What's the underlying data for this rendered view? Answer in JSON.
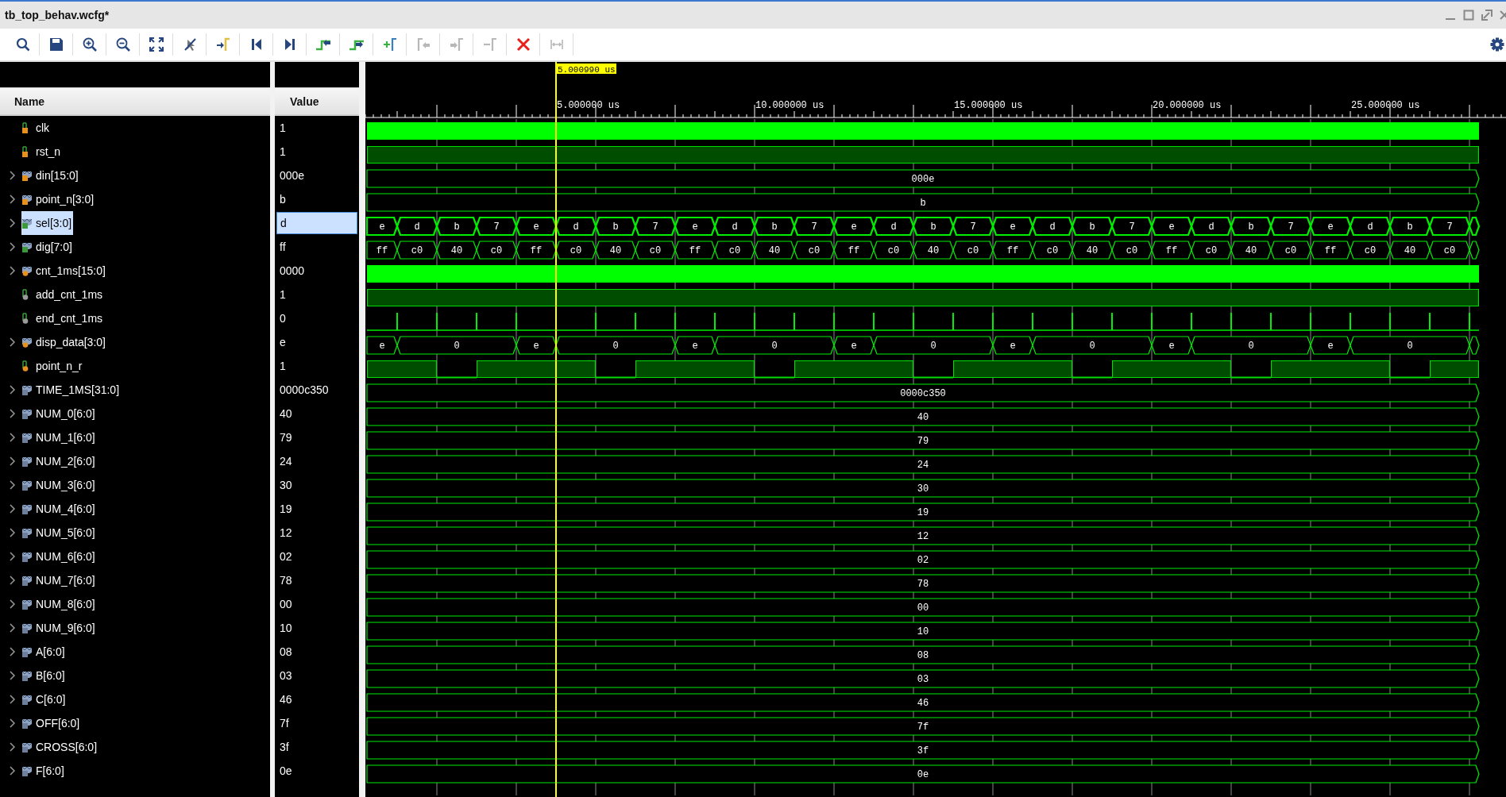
{
  "window": {
    "title": "tb_top_behav.wcfg*"
  },
  "toolbar": [
    {
      "kind": "search",
      "disabled": false
    },
    {
      "kind": "save",
      "disabled": false
    },
    {
      "kind": "zoom-in",
      "disabled": false
    },
    {
      "kind": "zoom-out",
      "disabled": false
    },
    {
      "kind": "zoom-fit",
      "disabled": false
    },
    {
      "kind": "snap",
      "disabled": false
    },
    {
      "kind": "go-cursor",
      "disabled": false
    },
    {
      "kind": "go-start",
      "disabled": false
    },
    {
      "kind": "go-end",
      "disabled": false
    },
    {
      "kind": "prev-edge",
      "disabled": false
    },
    {
      "kind": "next-edge",
      "disabled": false
    },
    {
      "kind": "add-marker",
      "disabled": false
    },
    {
      "kind": "prev-marker",
      "disabled": true
    },
    {
      "kind": "next-marker",
      "disabled": true
    },
    {
      "kind": "remove-marker",
      "disabled": true
    },
    {
      "kind": "delete",
      "disabled": false
    },
    {
      "kind": "swap",
      "disabled": true
    }
  ],
  "columns": [
    "Name",
    "Value"
  ],
  "cursor": {
    "time": "5.000990 us"
  },
  "ruler": {
    "labels": [
      "5.000000 us",
      "10.000000 us",
      "15.000000 us",
      "20.000000 us",
      "25.000000 us"
    ]
  },
  "signals": [
    {
      "name": "clk",
      "value": "1",
      "kind": "input",
      "bus": false,
      "expandable": false,
      "selected": false,
      "wave": {
        "kind": "clock"
      }
    },
    {
      "name": "rst_n",
      "value": "1",
      "kind": "input",
      "bus": false,
      "expandable": false,
      "selected": false,
      "wave": {
        "kind": "high"
      }
    },
    {
      "name": "din[15:0]",
      "value": "000e",
      "kind": "input",
      "bus": true,
      "expandable": true,
      "selected": false,
      "wave": {
        "kind": "constant",
        "value": "000e"
      }
    },
    {
      "name": "point_n[3:0]",
      "value": "b",
      "kind": "input",
      "bus": true,
      "expandable": true,
      "selected": false,
      "wave": {
        "kind": "constant",
        "value": "b"
      }
    },
    {
      "name": "sel[3:0]",
      "value": "d",
      "kind": "output",
      "bus": true,
      "expandable": true,
      "selected": true,
      "wave": {
        "kind": "bus",
        "segments": [
          {
            "value": "e",
            "kind": "unit"
          },
          {
            "value": "d",
            "kind": "unit"
          },
          {
            "value": "b",
            "kind": "unit"
          },
          {
            "value": "7",
            "kind": "unit"
          },
          {
            "value": "e",
            "kind": "unit"
          },
          {
            "value": "d",
            "kind": "unit"
          },
          {
            "value": "b",
            "kind": "unit"
          },
          {
            "value": "7",
            "kind": "unit"
          },
          {
            "value": "e",
            "kind": "unit"
          },
          {
            "value": "d",
            "kind": "unit"
          },
          {
            "value": "b",
            "kind": "unit"
          },
          {
            "value": "7",
            "kind": "unit"
          },
          {
            "value": "e",
            "kind": "unit"
          },
          {
            "value": "d",
            "kind": "unit"
          },
          {
            "value": "b",
            "kind": "unit"
          },
          {
            "value": "7",
            "kind": "unit"
          },
          {
            "value": "e",
            "kind": "unit"
          },
          {
            "value": "d",
            "kind": "unit"
          },
          {
            "value": "b",
            "kind": "unit"
          },
          {
            "value": "7",
            "kind": "unit"
          },
          {
            "value": "e",
            "kind": "unit"
          },
          {
            "value": "d",
            "kind": "unit"
          },
          {
            "value": "b",
            "kind": "unit"
          },
          {
            "value": "7",
            "kind": "unit"
          },
          {
            "value": "e",
            "kind": "unit"
          },
          {
            "value": "d",
            "kind": "unit"
          },
          {
            "value": "b",
            "kind": "unit"
          },
          {
            "value": "7",
            "kind": "unit"
          }
        ]
      }
    },
    {
      "name": "dig[7:0]",
      "value": "ff",
      "kind": "output",
      "bus": true,
      "expandable": true,
      "selected": false,
      "wave": {
        "kind": "bus",
        "segments": [
          {
            "value": "ff",
            "kind": "unit"
          },
          {
            "value": "c0",
            "kind": "unit"
          },
          {
            "value": "40",
            "kind": "unit"
          },
          {
            "value": "c0",
            "kind": "unit"
          },
          {
            "value": "ff",
            "kind": "unit"
          },
          {
            "value": "c0",
            "kind": "unit"
          },
          {
            "value": "40",
            "kind": "unit"
          },
          {
            "value": "c0",
            "kind": "unit"
          },
          {
            "value": "ff",
            "kind": "unit"
          },
          {
            "value": "c0",
            "kind": "unit"
          },
          {
            "value": "40",
            "kind": "unit"
          },
          {
            "value": "c0",
            "kind": "unit"
          },
          {
            "value": "ff",
            "kind": "unit"
          },
          {
            "value": "c0",
            "kind": "unit"
          },
          {
            "value": "40",
            "kind": "unit"
          },
          {
            "value": "c0",
            "kind": "unit"
          },
          {
            "value": "ff",
            "kind": "unit"
          },
          {
            "value": "c0",
            "kind": "unit"
          },
          {
            "value": "40",
            "kind": "unit"
          },
          {
            "value": "c0",
            "kind": "unit"
          },
          {
            "value": "ff",
            "kind": "unit"
          },
          {
            "value": "c0",
            "kind": "unit"
          },
          {
            "value": "40",
            "kind": "unit"
          },
          {
            "value": "c0",
            "kind": "unit"
          },
          {
            "value": "ff",
            "kind": "unit"
          },
          {
            "value": "c0",
            "kind": "unit"
          },
          {
            "value": "40",
            "kind": "unit"
          },
          {
            "value": "c0",
            "kind": "unit"
          }
        ]
      }
    },
    {
      "name": "cnt_1ms[15:0]",
      "value": "0000",
      "kind": "reg",
      "bus": true,
      "expandable": true,
      "selected": false,
      "wave": {
        "kind": "clock"
      }
    },
    {
      "name": "add_cnt_1ms",
      "value": "1",
      "kind": "wire",
      "bus": false,
      "expandable": false,
      "selected": false,
      "wave": {
        "kind": "high"
      }
    },
    {
      "name": "end_cnt_1ms",
      "value": "0",
      "kind": "wire",
      "bus": false,
      "expandable": false,
      "selected": false,
      "wave": {
        "kind": "pulse"
      }
    },
    {
      "name": "disp_data[3:0]",
      "value": "e",
      "kind": "reg",
      "bus": true,
      "expandable": true,
      "selected": false,
      "wave": {
        "kind": "bus",
        "segments": [
          {
            "value": "e",
            "kind": "unit"
          },
          {
            "value": "0",
            "kind": "triple"
          },
          {
            "value": "e",
            "kind": "unit"
          },
          {
            "value": "0",
            "kind": "triple"
          },
          {
            "value": "e",
            "kind": "unit"
          },
          {
            "value": "0",
            "kind": "triple"
          },
          {
            "value": "e",
            "kind": "unit"
          },
          {
            "value": "0",
            "kind": "triple"
          },
          {
            "value": "e",
            "kind": "unit"
          },
          {
            "value": "0",
            "kind": "triple"
          },
          {
            "value": "e",
            "kind": "unit"
          },
          {
            "value": "0",
            "kind": "triple"
          },
          {
            "value": "e",
            "kind": "unit"
          },
          {
            "value": "0",
            "kind": "triple"
          }
        ]
      }
    },
    {
      "name": "point_n_r",
      "value": "1",
      "kind": "reg",
      "bus": false,
      "expandable": false,
      "selected": false,
      "wave": {
        "kind": "levels",
        "segments": [
          {
            "high": true,
            "kind": "double"
          },
          {
            "high": false,
            "kind": "unit"
          },
          {
            "high": true,
            "kind": "triple"
          },
          {
            "high": false,
            "kind": "unit"
          },
          {
            "high": true,
            "kind": "triple"
          },
          {
            "high": false,
            "kind": "unit"
          },
          {
            "high": true,
            "kind": "triple"
          },
          {
            "high": false,
            "kind": "unit"
          },
          {
            "high": true,
            "kind": "triple"
          },
          {
            "high": false,
            "kind": "unit"
          },
          {
            "high": true,
            "kind": "triple"
          },
          {
            "high": false,
            "kind": "unit"
          },
          {
            "high": true,
            "kind": "triple"
          },
          {
            "high": false,
            "kind": "unit"
          },
          {
            "high": true,
            "kind": "triple"
          }
        ]
      }
    },
    {
      "name": "TIME_1MS[31:0]",
      "value": "0000c350",
      "kind": "param",
      "bus": true,
      "expandable": true,
      "selected": false,
      "wave": {
        "kind": "constant",
        "value": "0000c350"
      }
    },
    {
      "name": "NUM_0[6:0]",
      "value": "40",
      "kind": "param",
      "bus": true,
      "expandable": true,
      "selected": false,
      "wave": {
        "kind": "constant",
        "value": "40"
      }
    },
    {
      "name": "NUM_1[6:0]",
      "value": "79",
      "kind": "param",
      "bus": true,
      "expandable": true,
      "selected": false,
      "wave": {
        "kind": "constant",
        "value": "79"
      }
    },
    {
      "name": "NUM_2[6:0]",
      "value": "24",
      "kind": "param",
      "bus": true,
      "expandable": true,
      "selected": false,
      "wave": {
        "kind": "constant",
        "value": "24"
      }
    },
    {
      "name": "NUM_3[6:0]",
      "value": "30",
      "kind": "param",
      "bus": true,
      "expandable": true,
      "selected": false,
      "wave": {
        "kind": "constant",
        "value": "30"
      }
    },
    {
      "name": "NUM_4[6:0]",
      "value": "19",
      "kind": "param",
      "bus": true,
      "expandable": true,
      "selected": false,
      "wave": {
        "kind": "constant",
        "value": "19"
      }
    },
    {
      "name": "NUM_5[6:0]",
      "value": "12",
      "kind": "param",
      "bus": true,
      "expandable": true,
      "selected": false,
      "wave": {
        "kind": "constant",
        "value": "12"
      }
    },
    {
      "name": "NUM_6[6:0]",
      "value": "02",
      "kind": "param",
      "bus": true,
      "expandable": true,
      "selected": false,
      "wave": {
        "kind": "constant",
        "value": "02"
      }
    },
    {
      "name": "NUM_7[6:0]",
      "value": "78",
      "kind": "param",
      "bus": true,
      "expandable": true,
      "selected": false,
      "wave": {
        "kind": "constant",
        "value": "78"
      }
    },
    {
      "name": "NUM_8[6:0]",
      "value": "00",
      "kind": "param",
      "bus": true,
      "expandable": true,
      "selected": false,
      "wave": {
        "kind": "constant",
        "value": "00"
      }
    },
    {
      "name": "NUM_9[6:0]",
      "value": "10",
      "kind": "param",
      "bus": true,
      "expandable": true,
      "selected": false,
      "wave": {
        "kind": "constant",
        "value": "10"
      }
    },
    {
      "name": "A[6:0]",
      "value": "08",
      "kind": "param",
      "bus": true,
      "expandable": true,
      "selected": false,
      "wave": {
        "kind": "constant",
        "value": "08"
      }
    },
    {
      "name": "B[6:0]",
      "value": "03",
      "kind": "param",
      "bus": true,
      "expandable": true,
      "selected": false,
      "wave": {
        "kind": "constant",
        "value": "03"
      }
    },
    {
      "name": "C[6:0]",
      "value": "46",
      "kind": "param",
      "bus": true,
      "expandable": true,
      "selected": false,
      "wave": {
        "kind": "constant",
        "value": "46"
      }
    },
    {
      "name": "OFF[6:0]",
      "value": "7f",
      "kind": "param",
      "bus": true,
      "expandable": true,
      "selected": false,
      "wave": {
        "kind": "constant",
        "value": "7f"
      }
    },
    {
      "name": "CROSS[6:0]",
      "value": "3f",
      "kind": "param",
      "bus": true,
      "expandable": true,
      "selected": false,
      "wave": {
        "kind": "constant",
        "value": "3f"
      }
    },
    {
      "name": "F[6:0]",
      "value": "0e",
      "kind": "param",
      "bus": true,
      "expandable": true,
      "selected": false,
      "wave": {
        "kind": "constant",
        "value": "0e"
      }
    }
  ]
}
